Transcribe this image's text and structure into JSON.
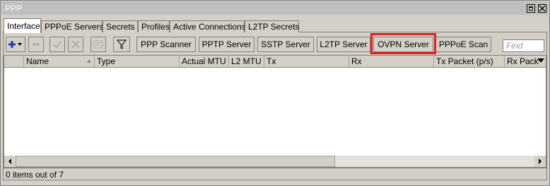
{
  "window": {
    "title": "PPP"
  },
  "tabs": [
    "Interface",
    "PPPoE Servers",
    "Secrets",
    "Profiles",
    "Active Connections",
    "L2TP Secrets"
  ],
  "active_tab": "Interface",
  "toolbar": {
    "icons": [
      "add-icon",
      "remove-icon",
      "enable-icon",
      "disable-icon",
      "comment-icon",
      "filter-icon"
    ],
    "buttons": [
      "PPP Scanner",
      "PPTP Server",
      "SSTP Server",
      "L2TP Server",
      "OVPN Server",
      "PPPoE Scan"
    ],
    "highlighted_button": "OVPN Server",
    "highlight_color": "#e0201a",
    "find_placeholder": "Find"
  },
  "table": {
    "columns": [
      "Name",
      "Type",
      "Actual MTU",
      "L2 MTU",
      "Tx",
      "Rx",
      "Tx Packet (p/s)",
      "Rx Pack"
    ],
    "rows": []
  },
  "status": {
    "text": "0 items out of 7"
  }
}
